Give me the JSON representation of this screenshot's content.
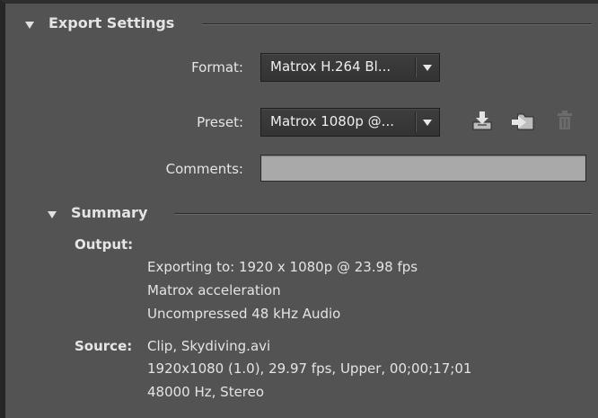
{
  "export_settings": {
    "title": "Export Settings",
    "format": {
      "label": "Format:",
      "value": "Matrox H.264 Bl..."
    },
    "preset": {
      "label": "Preset:",
      "value": "Matrox 1080p @...",
      "actions": [
        {
          "icon": "save-preset-icon"
        },
        {
          "icon": "import-preset-icon"
        },
        {
          "icon": "delete-preset-icon",
          "disabled": true
        }
      ]
    },
    "comments": {
      "label": "Comments:",
      "value": ""
    }
  },
  "summary": {
    "title": "Summary",
    "output": {
      "label": "Output:",
      "lines": [
        "Exporting to: 1920 x 1080p @ 23.98 fps",
        "Matrox acceleration",
        "Uncompressed 48 kHz Audio"
      ]
    },
    "source": {
      "label": "Source:",
      "lines": [
        "Clip, Skydiving.avi",
        "1920x1080 (1.0), 29.97 fps, Upper, 00;00;17;01",
        "48000 Hz, Stereo"
      ]
    }
  },
  "colors": {
    "panel_background": "#535353",
    "dropdown_background": "#383838",
    "comments_field": "#a9a9a9",
    "text": "#e4e4e4"
  }
}
